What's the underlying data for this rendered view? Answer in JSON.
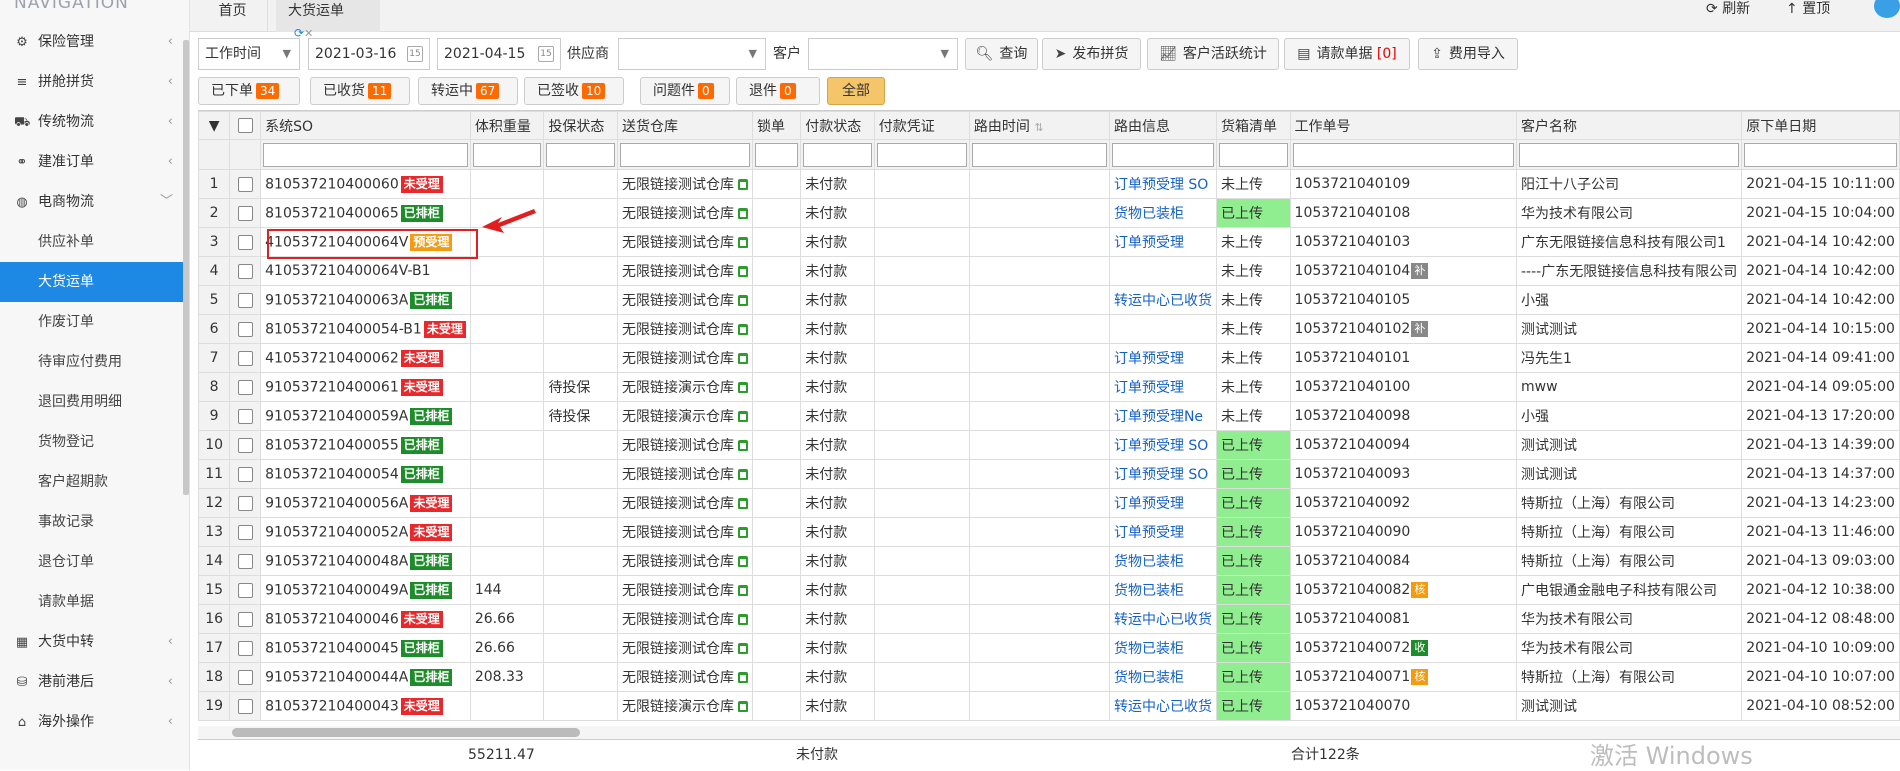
{
  "sidebar": {
    "header": "NAVIGATION",
    "items": [
      {
        "label": "保险管理",
        "icon": "gear-icon"
      },
      {
        "label": "拼舱拼货",
        "icon": "layers-icon"
      },
      {
        "label": "传统物流",
        "icon": "truck-icon"
      },
      {
        "label": "建准订单",
        "icon": "link-icon"
      },
      {
        "label": "电商物流",
        "icon": "globe-icon",
        "expanded": true
      }
    ],
    "subitems": [
      {
        "label": "供应补单"
      },
      {
        "label": "大货运单",
        "active": true
      },
      {
        "label": "作废订单"
      },
      {
        "label": "待审应付费用"
      },
      {
        "label": "退回费用明细"
      },
      {
        "label": "货物登记"
      },
      {
        "label": "客户超期款"
      },
      {
        "label": "事故记录"
      },
      {
        "label": "退仓订单"
      },
      {
        "label": "请款单据"
      }
    ],
    "bottom_items": [
      {
        "label": "大货中转",
        "icon": "grid-icon"
      },
      {
        "label": "港前港后",
        "icon": "boxes-icon"
      },
      {
        "label": "海外操作",
        "icon": "hat-icon"
      }
    ]
  },
  "tabs": {
    "home": "首页",
    "current": "大货运单"
  },
  "topbar": {
    "refresh": "刷新",
    "top": "置顶"
  },
  "filters": {
    "time_type": "工作时间",
    "date_from": "2021-03-16",
    "date_to": "2021-04-15",
    "supplier_label": "供应商",
    "customer_label": "客户",
    "search_btn": "查询",
    "publish_btn": "发布拼货",
    "stats_btn": "客户活跃统计",
    "request_btn": "请款单据",
    "request_count": "[0]",
    "import_btn": "费用导入"
  },
  "status_tabs": [
    {
      "label": "已下单",
      "count": "34"
    },
    {
      "label": "已收货",
      "count": "11"
    },
    {
      "label": "转运中",
      "count": "67"
    },
    {
      "label": "已签收",
      "count": "10"
    },
    {
      "label": "问题件",
      "count": "0"
    },
    {
      "label": "退件",
      "count": "0"
    },
    {
      "label": "全部",
      "count": ""
    }
  ],
  "table": {
    "columns": [
      "系统SO",
      "体积重量",
      "投保状态",
      "送货仓库",
      "锁单",
      "付款状态",
      "付款凭证",
      "路由时间",
      "路由信息",
      "货箱清单",
      "工作单号",
      "客户名称",
      "原下单日期"
    ],
    "rows": [
      {
        "n": "1",
        "so": "810537210400060",
        "badge": "未受理",
        "bc": "b-red",
        "vol": "",
        "ins": "",
        "wh": "无限链接测试仓库",
        "pay": "未付款",
        "route": "订单预受理 SO",
        "box": "未上传",
        "up": false,
        "job": "1053721040109",
        "tag": "",
        "tc": "",
        "cust": "阳江十八子公司",
        "date": "2021-04-15 10:11:00"
      },
      {
        "n": "2",
        "so": "810537210400065",
        "badge": "已排柜",
        "bc": "b-green",
        "vol": "",
        "ins": "",
        "wh": "无限链接测试仓库",
        "pay": "未付款",
        "route": "货物已装柜",
        "box": "已上传",
        "up": true,
        "job": "1053721040108",
        "tag": "",
        "tc": "",
        "cust": "华为技术有限公司",
        "date": "2021-04-15 10:04:00"
      },
      {
        "n": "3",
        "so": "410537210400064V",
        "badge": "预受理",
        "bc": "b-orange",
        "vol": "",
        "ins": "",
        "wh": "无限链接测试仓库",
        "pay": "未付款",
        "route": "订单预受理",
        "box": "未上传",
        "up": false,
        "job": "1053721040103",
        "tag": "",
        "tc": "",
        "cust": "广东无限链接信息科技有限公司1",
        "date": "2021-04-14 10:42:00"
      },
      {
        "n": "4",
        "so": "410537210400064V-B1",
        "badge": "",
        "bc": "",
        "vol": "",
        "ins": "",
        "wh": "无限链接测试仓库",
        "pay": "未付款",
        "route": "",
        "box": "未上传",
        "up": false,
        "job": "1053721040104",
        "tag": "补",
        "tc": "t-gray",
        "cust": "----广东无限链接信息科技有限公司",
        "date": "2021-04-14 10:42:00"
      },
      {
        "n": "5",
        "so": "910537210400063A",
        "badge": "已排柜",
        "bc": "b-green",
        "vol": "",
        "ins": "",
        "wh": "无限链接测试仓库",
        "pay": "未付款",
        "route": "转运中心已收货",
        "box": "未上传",
        "up": false,
        "job": "1053721040105",
        "tag": "",
        "tc": "",
        "cust": "小强",
        "date": "2021-04-14 10:42:00"
      },
      {
        "n": "6",
        "so": "810537210400054-B1",
        "badge": "未受理",
        "bc": "b-red",
        "vol": "",
        "ins": "",
        "wh": "无限链接测试仓库",
        "pay": "未付款",
        "route": "",
        "box": "未上传",
        "up": false,
        "job": "1053721040102",
        "tag": "补",
        "tc": "t-gray",
        "cust": "测试测试",
        "date": "2021-04-14 10:15:00"
      },
      {
        "n": "7",
        "so": "410537210400062",
        "badge": "未受理",
        "bc": "b-red",
        "vol": "",
        "ins": "",
        "wh": "无限链接测试仓库",
        "pay": "未付款",
        "route": "订单预受理",
        "box": "未上传",
        "up": false,
        "job": "1053721040101",
        "tag": "",
        "tc": "",
        "cust": "冯先生1",
        "date": "2021-04-14 09:41:00"
      },
      {
        "n": "8",
        "so": "910537210400061",
        "badge": "未受理",
        "bc": "b-red",
        "vol": "",
        "ins": "待投保",
        "wh": "无限链接演示仓库",
        "pay": "未付款",
        "route": "订单预受理",
        "box": "未上传",
        "up": false,
        "job": "1053721040100",
        "tag": "",
        "tc": "",
        "cust": "mww",
        "date": "2021-04-14 09:05:00"
      },
      {
        "n": "9",
        "so": "910537210400059A",
        "badge": "已排柜",
        "bc": "b-green",
        "vol": "",
        "ins": "待投保",
        "wh": "无限链接演示仓库",
        "pay": "未付款",
        "route": "订单预受理Ne",
        "box": "未上传",
        "up": false,
        "job": "1053721040098",
        "tag": "",
        "tc": "",
        "cust": "小强",
        "date": "2021-04-13 17:20:00"
      },
      {
        "n": "10",
        "so": "810537210400055",
        "badge": "已排柜",
        "bc": "b-green",
        "vol": "",
        "ins": "",
        "wh": "无限链接测试仓库",
        "pay": "未付款",
        "route": "订单预受理 SO",
        "box": "已上传",
        "up": true,
        "job": "1053721040094",
        "tag": "",
        "tc": "",
        "cust": "测试测试",
        "date": "2021-04-13 14:39:00"
      },
      {
        "n": "11",
        "so": "810537210400054",
        "badge": "已排柜",
        "bc": "b-green",
        "vol": "",
        "ins": "",
        "wh": "无限链接测试仓库",
        "pay": "未付款",
        "route": "订单预受理 SO",
        "box": "已上传",
        "up": true,
        "job": "1053721040093",
        "tag": "",
        "tc": "",
        "cust": "测试测试",
        "date": "2021-04-13 14:37:00"
      },
      {
        "n": "12",
        "so": "910537210400056A",
        "badge": "未受理",
        "bc": "b-red",
        "vol": "",
        "ins": "",
        "wh": "无限链接测试仓库",
        "pay": "未付款",
        "route": "订单预受理",
        "box": "已上传",
        "up": true,
        "job": "1053721040092",
        "tag": "",
        "tc": "",
        "cust": "特斯拉（上海）有限公司",
        "date": "2021-04-13 14:23:00"
      },
      {
        "n": "13",
        "so": "910537210400052A",
        "badge": "未受理",
        "bc": "b-red",
        "vol": "",
        "ins": "",
        "wh": "无限链接测试仓库",
        "pay": "未付款",
        "route": "订单预受理",
        "box": "已上传",
        "up": true,
        "job": "1053721040090",
        "tag": "",
        "tc": "",
        "cust": "特斯拉（上海）有限公司",
        "date": "2021-04-13 11:46:00"
      },
      {
        "n": "14",
        "so": "910537210400048A",
        "badge": "已排柜",
        "bc": "b-green",
        "vol": "",
        "ins": "",
        "wh": "无限链接测试仓库",
        "pay": "未付款",
        "route": "货物已装柜",
        "box": "已上传",
        "up": true,
        "job": "1053721040084",
        "tag": "",
        "tc": "",
        "cust": "特斯拉（上海）有限公司",
        "date": "2021-04-13 09:03:00"
      },
      {
        "n": "15",
        "so": "910537210400049A",
        "badge": "已排柜",
        "bc": "b-green",
        "vol": "144",
        "ins": "",
        "wh": "无限链接测试仓库",
        "pay": "未付款",
        "route": "货物已装柜",
        "box": "已上传",
        "up": true,
        "job": "1053721040082",
        "tag": "核",
        "tc": "t-orange",
        "cust": "广电银通金融电子科技有限公司",
        "date": "2021-04-12 10:38:00"
      },
      {
        "n": "16",
        "so": "810537210400046",
        "badge": "未受理",
        "bc": "b-red",
        "vol": "26.66",
        "ins": "",
        "wh": "无限链接测试仓库",
        "pay": "未付款",
        "route": "转运中心已收货",
        "box": "已上传",
        "up": true,
        "job": "1053721040081",
        "tag": "",
        "tc": "",
        "cust": "华为技术有限公司",
        "date": "2021-04-12 08:48:00"
      },
      {
        "n": "17",
        "so": "810537210400045",
        "badge": "已排柜",
        "bc": "b-green",
        "vol": "26.66",
        "ins": "",
        "wh": "无限链接测试仓库",
        "pay": "未付款",
        "route": "货物已装柜",
        "box": "已上传",
        "up": true,
        "job": "1053721040072",
        "tag": "收",
        "tc": "t-green",
        "cust": "华为技术有限公司",
        "date": "2021-04-10 10:09:00"
      },
      {
        "n": "18",
        "so": "910537210400044A",
        "badge": "已排柜",
        "bc": "b-green",
        "vol": "208.33",
        "ins": "",
        "wh": "无限链接测试仓库",
        "pay": "未付款",
        "route": "货物已装柜",
        "box": "已上传",
        "up": true,
        "job": "1053721040071",
        "tag": "核",
        "tc": "t-orange",
        "cust": "特斯拉（上海）有限公司",
        "date": "2021-04-10 10:07:00"
      },
      {
        "n": "19",
        "so": "810537210400043",
        "badge": "未受理",
        "bc": "b-red",
        "vol": "",
        "ins": "",
        "wh": "无限链接演示仓库",
        "pay": "未付款",
        "route": "转运中心已收货",
        "box": "已上传",
        "up": true,
        "job": "1053721040070",
        "tag": "",
        "tc": "",
        "cust": "测试测试",
        "date": "2021-04-10 08:52:00"
      }
    ],
    "footer": {
      "vol_total": "55211.47",
      "pay": "未付款",
      "total": "合计122条"
    }
  },
  "watermark": "激活 Windows"
}
